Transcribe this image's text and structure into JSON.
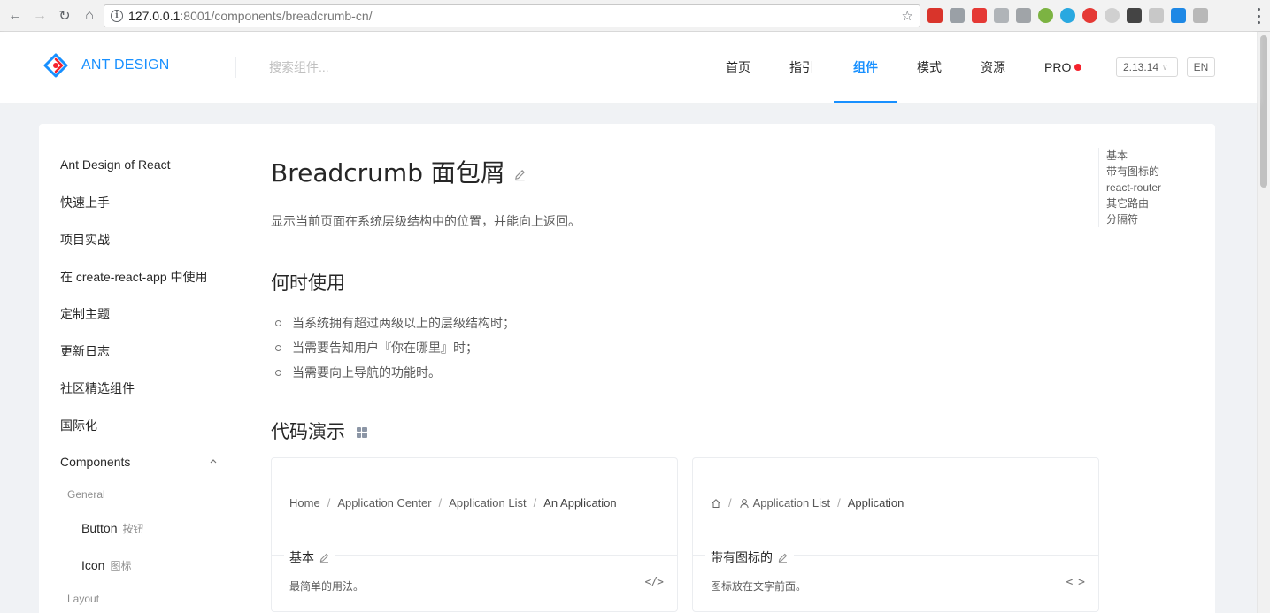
{
  "browser": {
    "url_host": "127.0.0.1",
    "url_rest": ":8001/components/breadcrumb-cn/"
  },
  "header": {
    "logo_text": "ANT DESIGN",
    "search_placeholder": "搜索组件...",
    "menu": [
      "首页",
      "指引",
      "组件",
      "模式",
      "资源",
      "PRO"
    ],
    "active_menu": "组件",
    "version": "2.13.14",
    "lang": "EN"
  },
  "sidebar": {
    "items": [
      "Ant Design of React",
      "快速上手",
      "项目实战",
      "在 create-react-app 中使用",
      "定制主题",
      "更新日志",
      "社区精选组件",
      "国际化"
    ],
    "components_label": "Components",
    "group_general": "General",
    "button_en": "Button",
    "button_cn": "按钮",
    "icon_en": "Icon",
    "icon_cn": "图标",
    "group_layout": "Layout"
  },
  "article": {
    "title": "Breadcrumb 面包屑",
    "description": "显示当前页面在系统层级结构中的位置，并能向上返回。",
    "when_title": "何时使用",
    "bullets": [
      "当系统拥有超过两级以上的层级结构时；",
      "当需要告知用户『你在哪里』时；",
      "当需要向上导航的功能时。"
    ],
    "demo_title": "代码演示"
  },
  "demos": [
    {
      "crumbs": [
        "Home",
        "Application Center",
        "Application List",
        "An Application"
      ],
      "title": "基本",
      "desc": "最简单的用法。"
    },
    {
      "crumbs": [
        "Application List",
        "Application"
      ],
      "title": "带有图标的",
      "desc": "图标放在文字前面。"
    }
  ],
  "toc": [
    "基本",
    "带有图标的",
    "react-router",
    "其它路由",
    "分隔符"
  ],
  "colors": {
    "primary": "#1890ff",
    "pro_dot": "#f5222d"
  }
}
